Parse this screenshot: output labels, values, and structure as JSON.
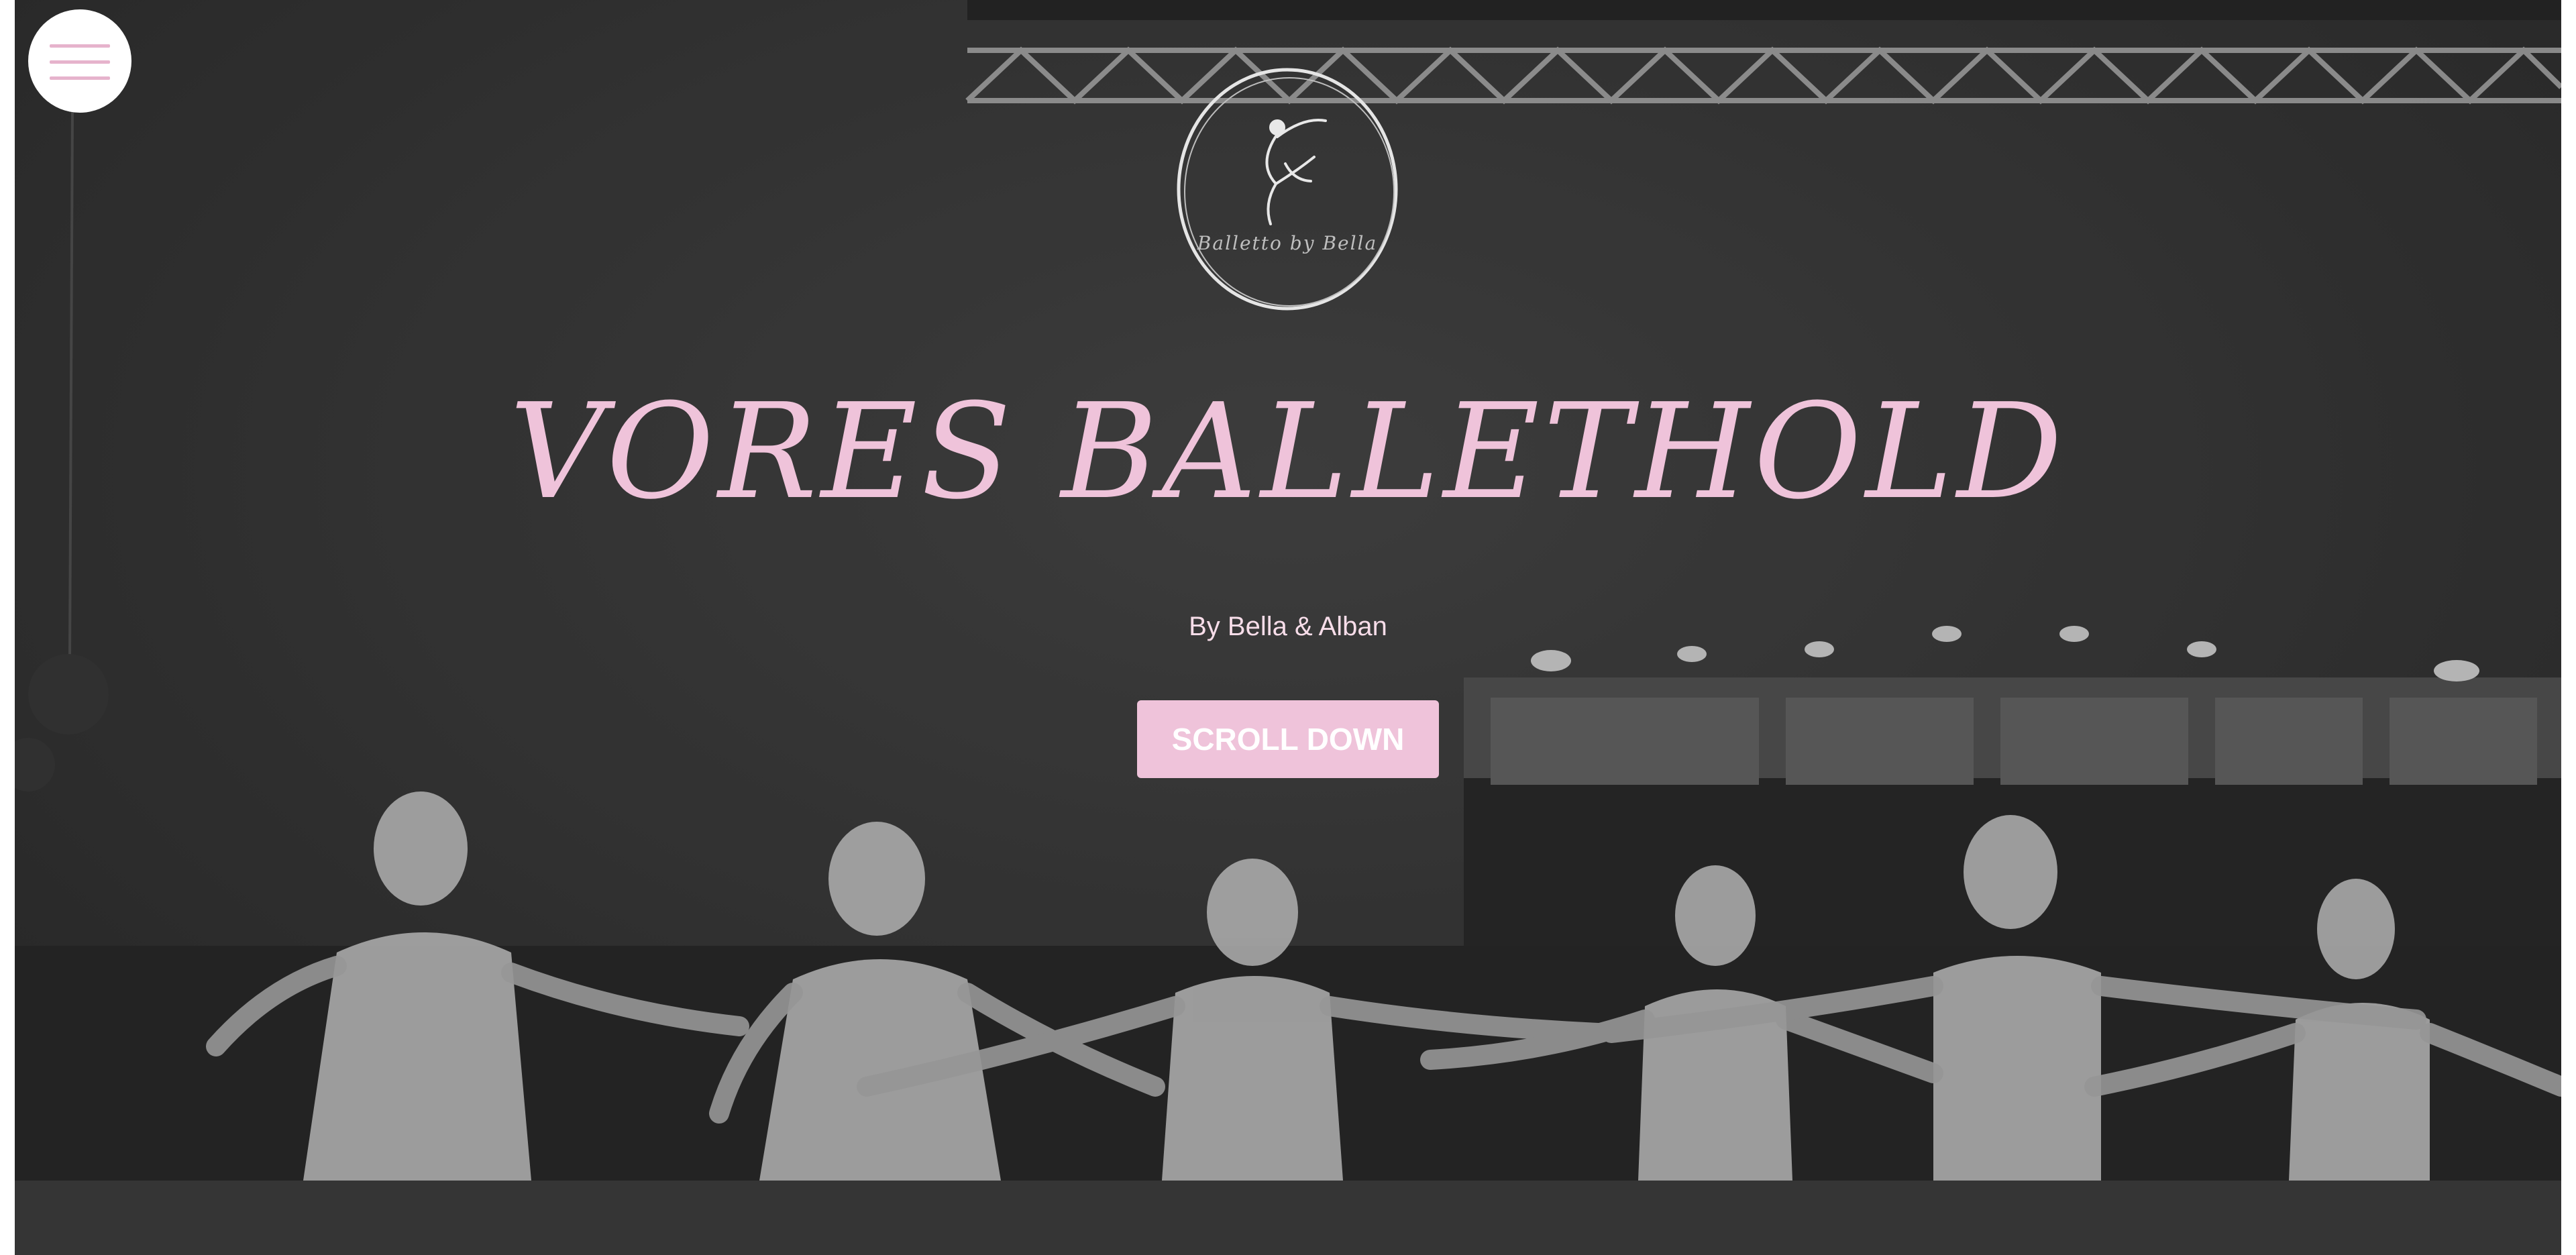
{
  "menu": {
    "icon": "hamburger-icon",
    "accent": "#e6b3cc"
  },
  "logo": {
    "text": "Balletto by Bella",
    "icon": "ballerina-icon"
  },
  "hero": {
    "title": "VORES BALLETHOLD",
    "subtitle": "By Bella & Alban",
    "cta_label": "SCROLL DOWN",
    "accent_color": "#efc3da",
    "background_image": "grayscale-photo-ballet-dancers-on-stage"
  }
}
